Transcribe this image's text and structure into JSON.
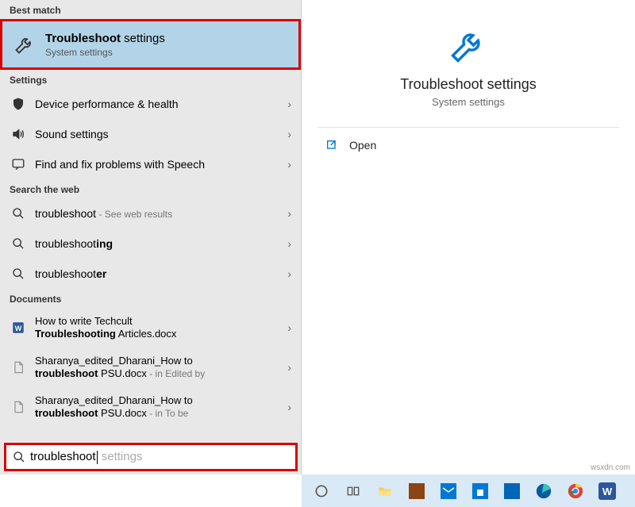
{
  "sections": {
    "best_match": "Best match",
    "settings": "Settings",
    "web": "Search the web",
    "documents": "Documents"
  },
  "best_match_item": {
    "title_bold": "Troubleshoot",
    "title_rest": " settings",
    "subtitle": "System settings"
  },
  "settings_items": [
    {
      "label": "Device performance & health"
    },
    {
      "label": "Sound settings"
    },
    {
      "label": "Find and fix problems with Speech"
    }
  ],
  "web_items": [
    {
      "prefix": "troubleshoot",
      "bold": "",
      "hint": " - See web results"
    },
    {
      "prefix": "troubleshoot",
      "bold": "ing",
      "hint": ""
    },
    {
      "prefix": "troubleshoot",
      "bold": "er",
      "hint": ""
    }
  ],
  "doc_items": [
    {
      "line1": "How to write Techcult",
      "line2_bold": "Troubleshooting",
      "line2_rest": " Articles.docx",
      "hint": ""
    },
    {
      "line1": "Sharanya_edited_Dharani_How to",
      "line2_bold": "troubleshoot",
      "line2_rest": " PSU.docx",
      "hint": " - in Edited by"
    },
    {
      "line1": "Sharanya_edited_Dharani_How to",
      "line2_bold": "troubleshoot",
      "line2_rest": " PSU.docx",
      "hint": " - in To be"
    }
  ],
  "search": {
    "typed": "troubleshoot",
    "ghost": " settings"
  },
  "preview": {
    "title": "Troubleshoot settings",
    "subtitle": "System settings",
    "open": "Open"
  },
  "watermark": "wsxdn.com"
}
